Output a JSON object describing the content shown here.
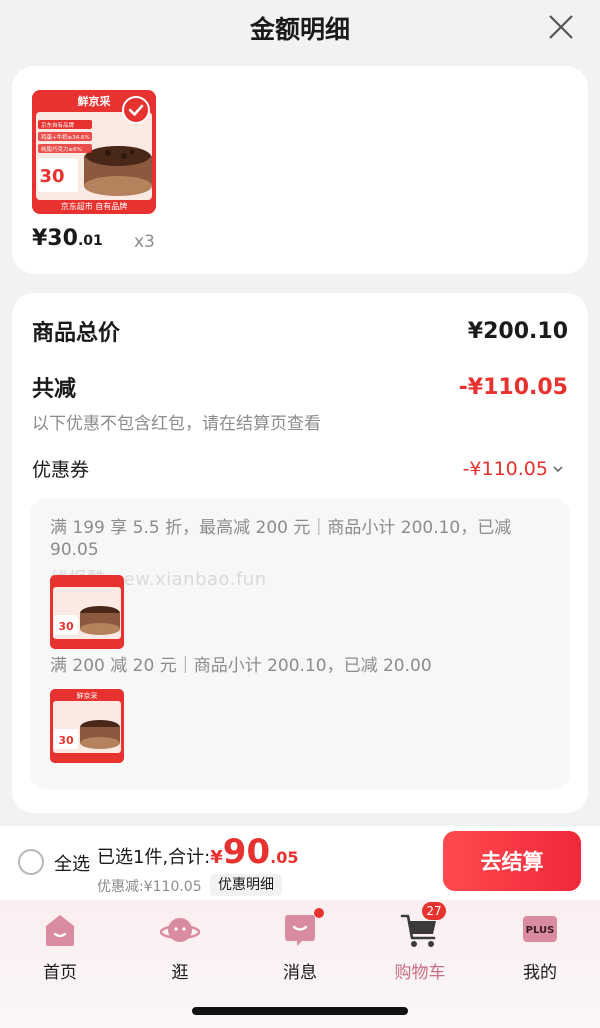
{
  "header": {
    "title": "金额明细"
  },
  "product": {
    "thumb_brand": "鲜京采",
    "thumb_footer": "京东超市 自有品牌",
    "thumb_tags": [
      "京东自有品牌",
      "鸡蛋+牛奶≥34.6%",
      "纯脂巧克力≥6%"
    ],
    "thumb_price": "30",
    "price_int": "¥30",
    "price_dec": ".01",
    "qty": "x3"
  },
  "summary": {
    "total_label": "商品总价",
    "total_value": "¥200.10",
    "discount_label": "共减",
    "discount_value": "-¥110.05",
    "note": "以下优惠不包含红包，请在结算页查看",
    "coupon_label": "优惠券",
    "coupon_value": "-¥110.05"
  },
  "coupons": [
    {
      "line1": "满 199 享 5.5 折，最高减 200 元｜商品小计 200.10，已减",
      "line2": "90.05"
    },
    {
      "line1": "满 200 减 20 元｜商品小计 200.10，已减 20.00"
    }
  ],
  "watermark": "线报酷 new.xianbao.fun",
  "bottom": {
    "select_all": "全选",
    "selected_text": "已选1件,合计:",
    "yen": "¥",
    "amount_int": "90",
    "amount_dec": ".05",
    "saved": "优惠减:¥110.05",
    "detail": "优惠明细",
    "checkout": "去结算"
  },
  "tabs": [
    {
      "label": "首页",
      "icon": "home-icon"
    },
    {
      "label": "逛",
      "icon": "planet-icon"
    },
    {
      "label": "消息",
      "icon": "message-icon"
    },
    {
      "label": "购物车",
      "icon": "cart-icon",
      "badge": "27",
      "active": true
    },
    {
      "label": "我的",
      "icon": "plus-member-icon",
      "icon_text": "PLUS"
    }
  ],
  "colors": {
    "accent_red": "#e8322f",
    "tab_active": "#c96f86"
  }
}
